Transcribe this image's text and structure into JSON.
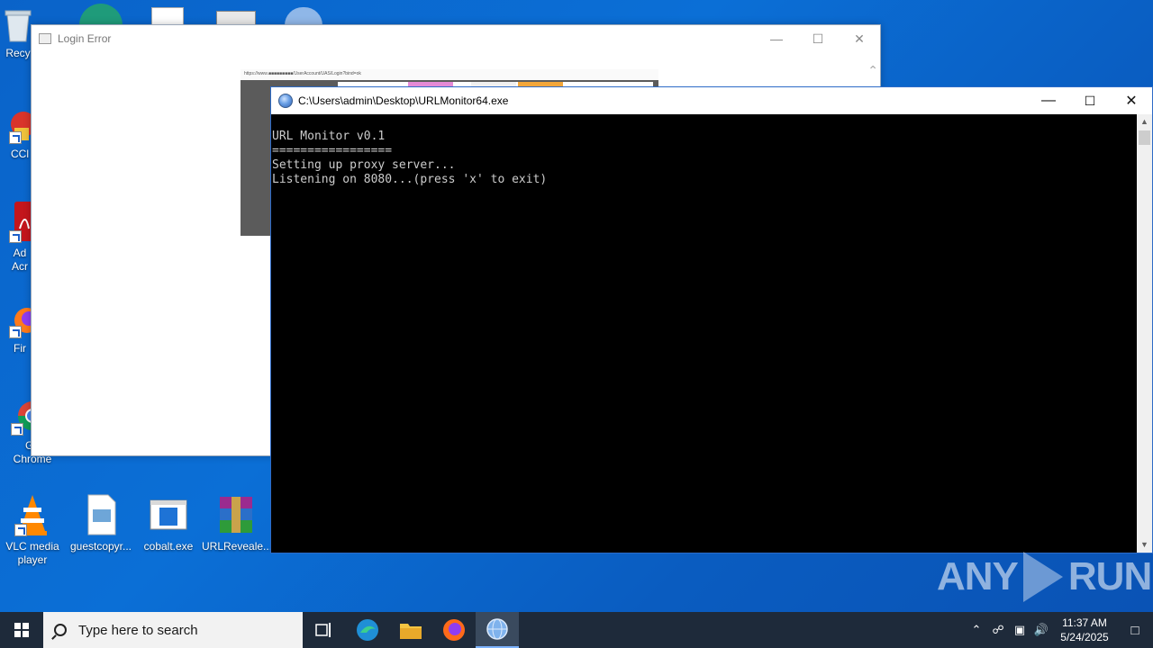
{
  "desktop": {
    "icons": [
      {
        "label": "Recy"
      },
      {
        "label": "CCl"
      },
      {
        "label": "Ad\nAcr"
      },
      {
        "label": "Fir"
      },
      {
        "label": "Go\nChrome"
      },
      {
        "label": "VLC media\nplayer"
      },
      {
        "label": "guestcopyr..."
      },
      {
        "label": "cobalt.exe"
      },
      {
        "label": "URLReveale..."
      }
    ]
  },
  "login_window": {
    "title": "Login Error",
    "address": "https://www.■■■■■■■■■/UserAccount/UAS/Login?bind=ok"
  },
  "console_window": {
    "title": "C:\\Users\\admin\\Desktop\\URLMonitor64.exe",
    "lines": [
      "URL Monitor v0.1",
      "=================",
      "Setting up proxy server...",
      "Listening on 8080...(press 'x' to exit)"
    ]
  },
  "watermark": {
    "left": "ANY",
    "right": "RUN"
  },
  "taskbar": {
    "search_placeholder": "Type here to search",
    "time": "11:37 AM",
    "date": "5/24/2025"
  },
  "colors": {
    "desktop_bg": "#0b6fd6",
    "taskbar_bg": "#1e2a3a",
    "console_bg": "#000000",
    "console_fg": "#cccccc"
  }
}
